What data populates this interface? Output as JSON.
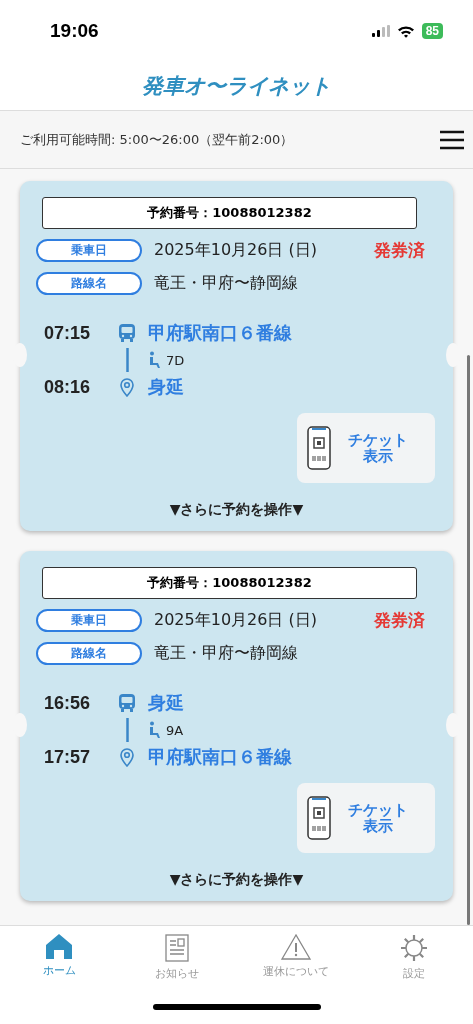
{
  "status_bar": {
    "time": "19:06",
    "battery": "85"
  },
  "header": {
    "title": "発車オ〜ライネット"
  },
  "info_bar": {
    "text": "ご利用可能時間: 5:00〜26:00（翌午前2:00）"
  },
  "reservations": [
    {
      "number": "予約番号：10088012382",
      "date_label": "乗車日",
      "date": "2025年10月26日 (日)",
      "status": "発券済",
      "route_label": "路線名",
      "route": "竜王・甲府〜静岡線",
      "departure_time": "07:15",
      "departure_stop": "甲府駅南口６番線",
      "seat": "7D",
      "arrival_time": "08:16",
      "arrival_stop": "身延",
      "ticket_button": "チケット表示",
      "more": "▼さらに予約を操作▼"
    },
    {
      "number": "予約番号：10088012382",
      "date_label": "乗車日",
      "date": "2025年10月26日 (日)",
      "status": "発券済",
      "route_label": "路線名",
      "route": "竜王・甲府〜静岡線",
      "departure_time": "16:56",
      "departure_stop": "身延",
      "seat": "9A",
      "arrival_time": "17:57",
      "arrival_stop": "甲府駅南口６番線",
      "ticket_button": "チケット表示",
      "more": "▼さらに予約を操作▼"
    }
  ],
  "tab_bar": [
    {
      "kind": "home",
      "label": "ホーム",
      "selected": true
    },
    {
      "kind": "news",
      "label": "お知らせ",
      "selected": false
    },
    {
      "kind": "warning",
      "label": "運休について",
      "selected": false
    },
    {
      "kind": "settings",
      "label": "設定",
      "selected": false
    }
  ]
}
